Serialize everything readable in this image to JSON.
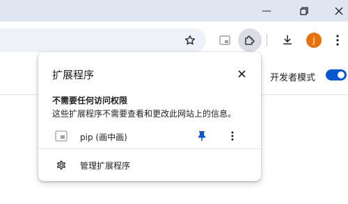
{
  "window": {
    "minimize_glyph": "—",
    "restore_glyph": "❐",
    "close_glyph": "✕"
  },
  "toolbar": {
    "avatar_letter": "j",
    "icons": [
      "star-icon",
      "picture-in-picture-icon",
      "puzzle-icon",
      "download-icon",
      "more-vert-icon"
    ],
    "colors": {
      "accent": "#0b57d0",
      "avatar": "#e8710a",
      "titlebar": "#dfe6f2"
    }
  },
  "page": {
    "developer_mode_label": "开发者模式",
    "developer_mode_on": true
  },
  "popup": {
    "title": "扩展程序",
    "section_heading": "不需要任何访问权限",
    "section_description": "这些扩展程序不需要查看和更改此网站上的信息。",
    "extensions": [
      {
        "name": "pip (画中画)",
        "pinned": true
      }
    ],
    "manage_label": "管理扩展程序"
  }
}
